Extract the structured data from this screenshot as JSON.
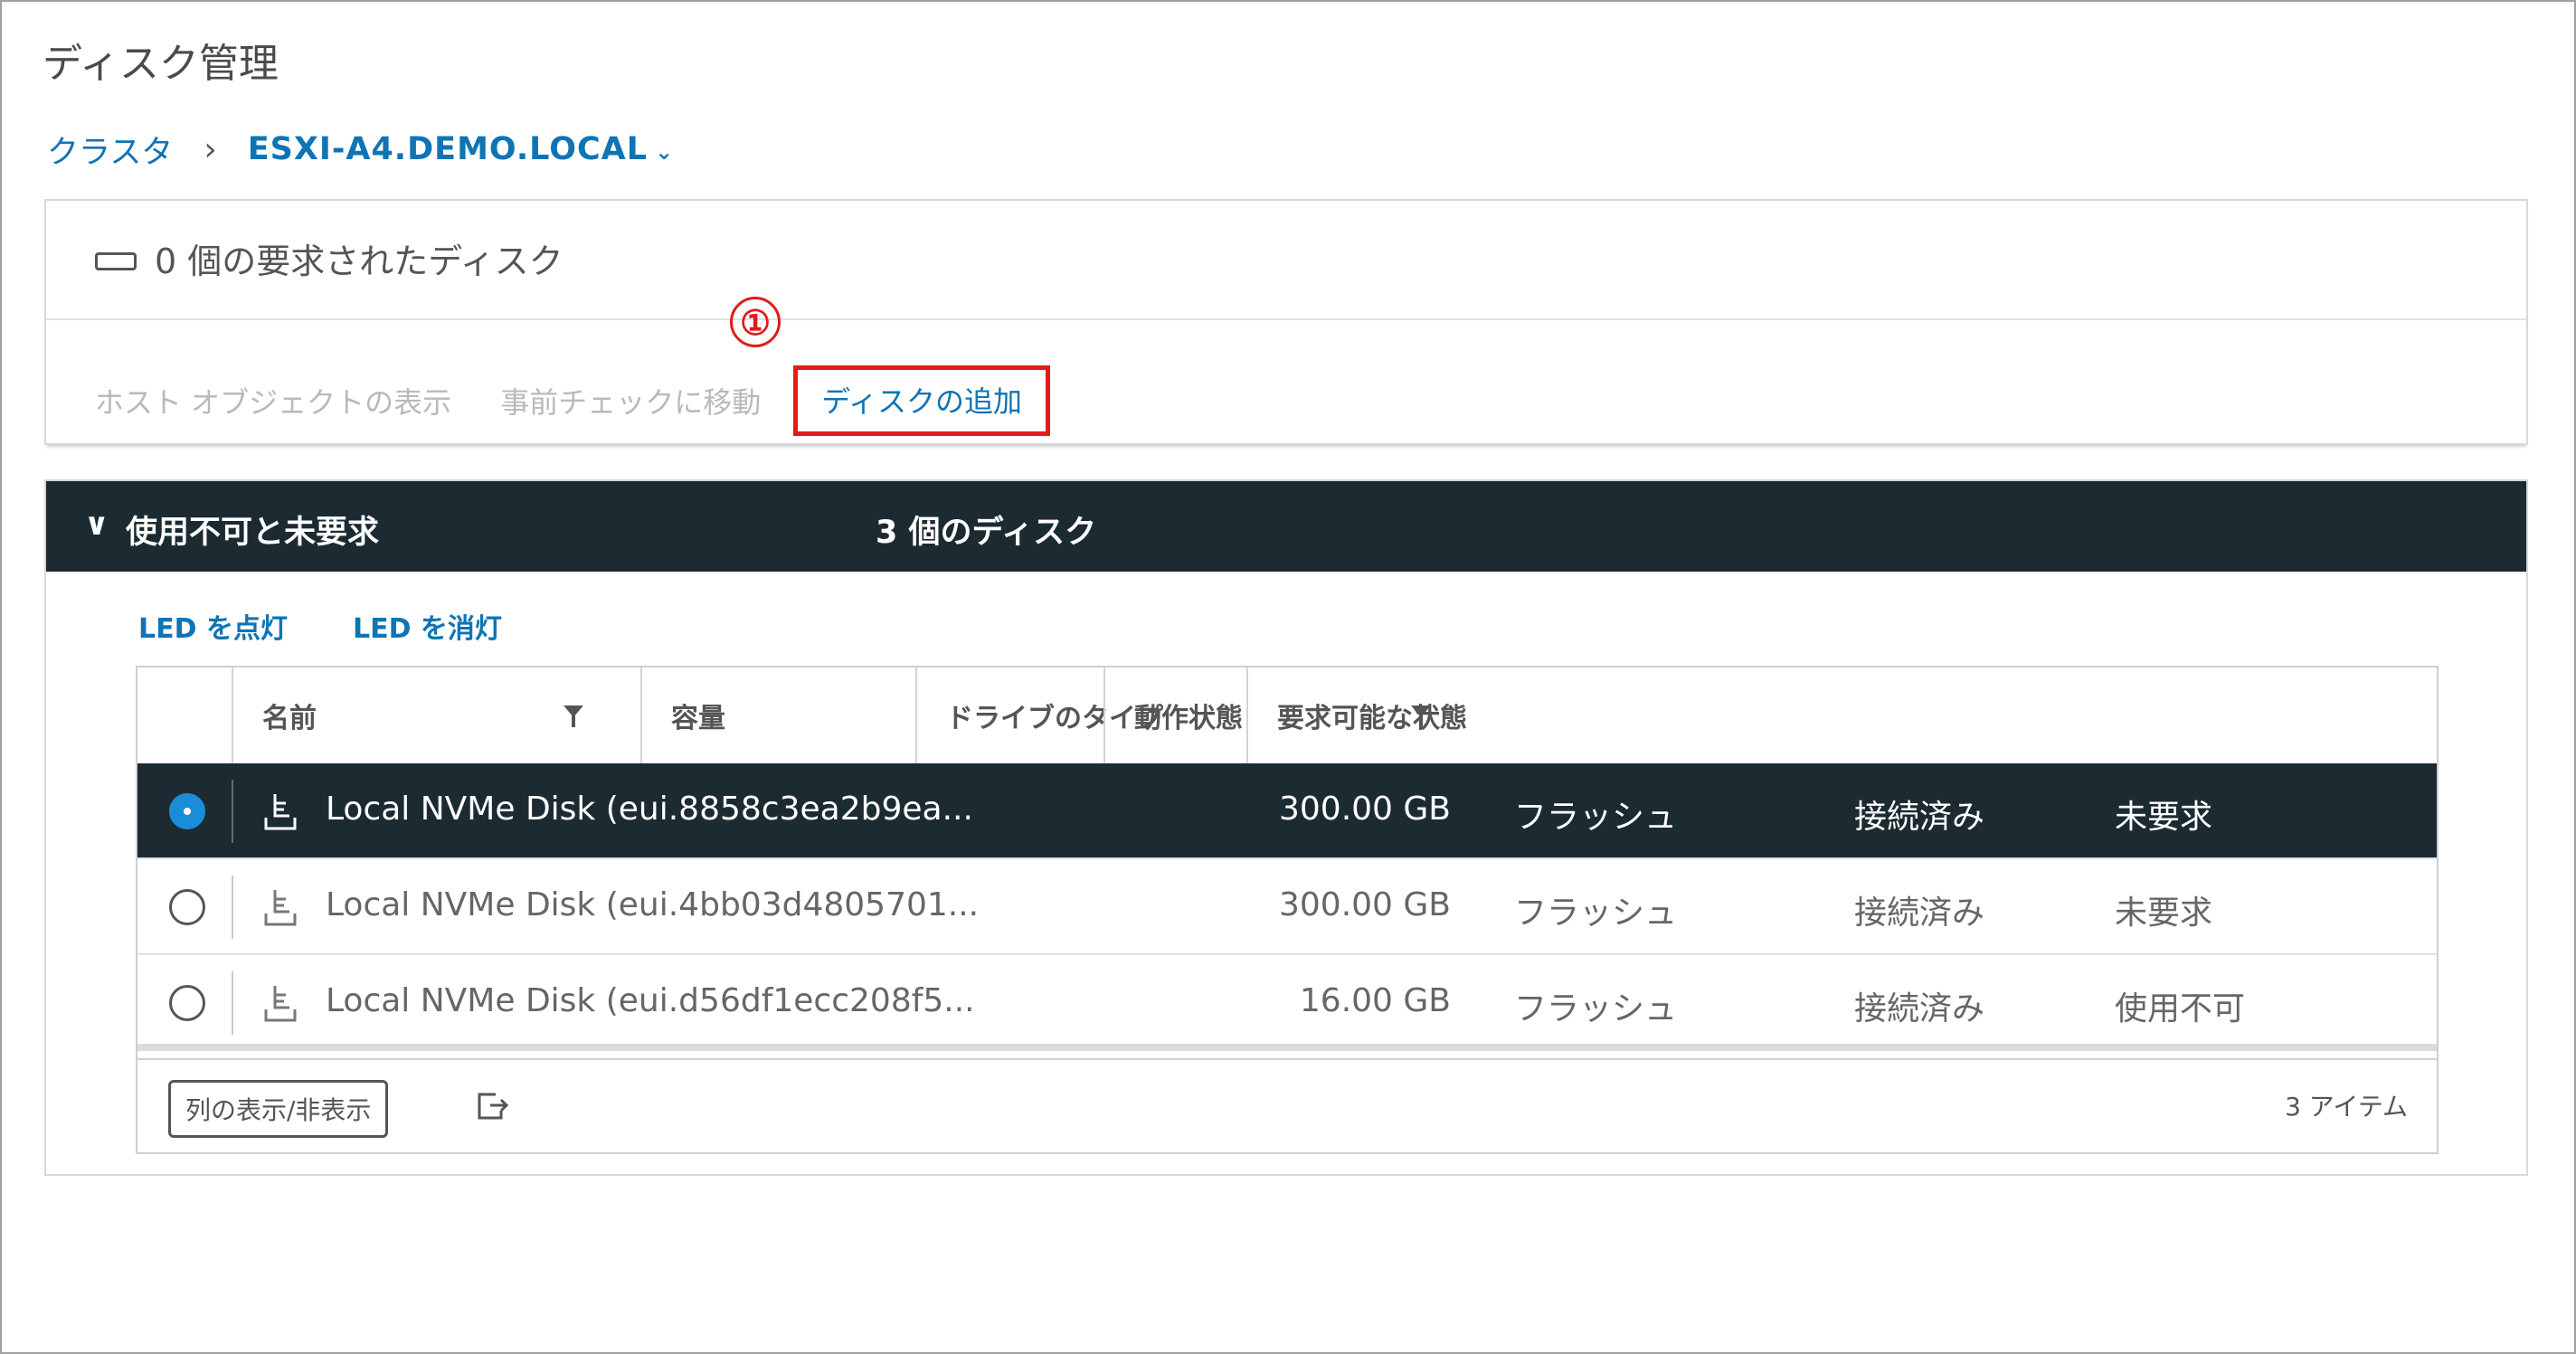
{
  "page": {
    "title": "ディスク管理"
  },
  "breadcrumb": {
    "cluster": "クラスタ",
    "separator": "›",
    "host": "ESXI-A4.DEMO.LOCAL",
    "caret": "⌄"
  },
  "claimed_summary": {
    "text": "0 個の要求されたディスク"
  },
  "actions": {
    "show_host_objects": "ホスト オブジェクトの表示",
    "go_to_precheck": "事前チェックに移動",
    "add_disk": "ディスクの追加"
  },
  "annotation_marker": "①",
  "section": {
    "chevron": "∨",
    "label": "使用不可と未要求",
    "count": "3 個のディスク",
    "led_on": "LED を点灯",
    "led_off": "LED を消灯"
  },
  "grid": {
    "columns": [
      "名前",
      "容量",
      "ドライブのタイプ",
      "動作状態",
      "要求可能な状態"
    ],
    "rows": [
      {
        "name": "Local NVMe Disk (eui.8858c3ea2b9ea...",
        "capacity": "300.00 GB",
        "type": "フラッシュ",
        "status": "接続済み",
        "claim": "未要求",
        "selected": true
      },
      {
        "name": "Local NVMe Disk (eui.4bb03d4805701...",
        "capacity": "300.00 GB",
        "type": "フラッシュ",
        "status": "接続済み",
        "claim": "未要求",
        "selected": false
      },
      {
        "name": "Local NVMe Disk (eui.d56df1ecc208f5...",
        "capacity": "16.00 GB",
        "type": "フラッシュ",
        "status": "接続済み",
        "claim": "使用不可",
        "selected": false
      }
    ],
    "footer": {
      "column_toggle": "列の表示/非表示",
      "item_count": "3 アイテム"
    }
  },
  "colors": {
    "accent_blue": "#0e74b5",
    "header_dark": "#1c2b32",
    "highlight_red": "#e21b1b"
  }
}
